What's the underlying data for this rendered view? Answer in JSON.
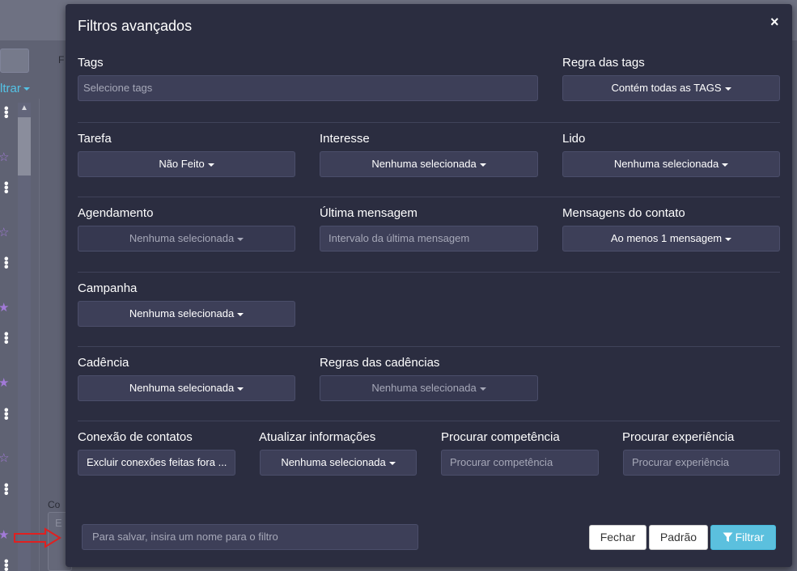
{
  "background": {
    "filtrar_label": "ltrar",
    "f_label": "F",
    "con_label": "Co",
    "input_placeholder": "E"
  },
  "modal": {
    "title": "Filtros avançados",
    "close_symbol": "×"
  },
  "filters": {
    "tags": {
      "label": "Tags",
      "placeholder": "Selecione tags"
    },
    "regra_tags": {
      "label": "Regra das tags",
      "value": "Contém todas as TAGS"
    },
    "tarefa": {
      "label": "Tarefa",
      "value": "Não Feito"
    },
    "interesse": {
      "label": "Interesse",
      "value": "Nenhuma selecionada"
    },
    "lido": {
      "label": "Lido",
      "value": "Nenhuma selecionada"
    },
    "agendamento": {
      "label": "Agendamento",
      "value": "Nenhuma selecionada"
    },
    "ultima_mensagem": {
      "label": "Última mensagem",
      "placeholder": "Intervalo da última mensagem"
    },
    "mensagens_contato": {
      "label": "Mensagens do contato",
      "value": "Ao menos 1 mensagem"
    },
    "campanha": {
      "label": "Campanha",
      "value": "Nenhuma selecionada"
    },
    "cadencia": {
      "label": "Cadência",
      "value": "Nenhuma selecionada"
    },
    "regras_cadencias": {
      "label": "Regras das cadências",
      "value": "Nenhuma selecionada"
    },
    "conexao_contatos": {
      "label": "Conexão de contatos",
      "value": "Excluir conexões feitas fora ..."
    },
    "atualizar_info": {
      "label": "Atualizar informações",
      "value": "Nenhuma selecionada"
    },
    "procurar_competencia": {
      "label": "Procurar competência",
      "placeholder": "Procurar competência"
    },
    "procurar_experiencia": {
      "label": "Procurar experiência",
      "placeholder": "Procurar experiência"
    }
  },
  "footer": {
    "filter_name_placeholder": "Para salvar, insira um nome para o filtro",
    "fechar_label": "Fechar",
    "padrao_label": "Padrão",
    "filtrar_label": "Filtrar"
  },
  "colors": {
    "modal_bg": "#2b2d40",
    "primary": "#5bc0de",
    "star": "#a27ad8",
    "arrow": "#e02020"
  }
}
